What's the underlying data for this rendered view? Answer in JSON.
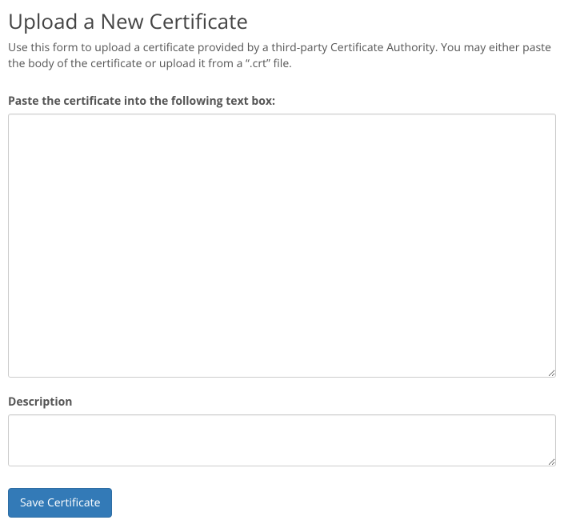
{
  "header": {
    "title": "Upload a New Certificate",
    "intro": "Use this form to upload a certificate provided by a third-party Certificate Authority. You may either paste the body of the certificate or upload it from a “.crt” file."
  },
  "form": {
    "certificate": {
      "label": "Paste the certificate into the following text box:",
      "value": ""
    },
    "description": {
      "label": "Description",
      "value": ""
    },
    "save_label": "Save Certificate"
  }
}
